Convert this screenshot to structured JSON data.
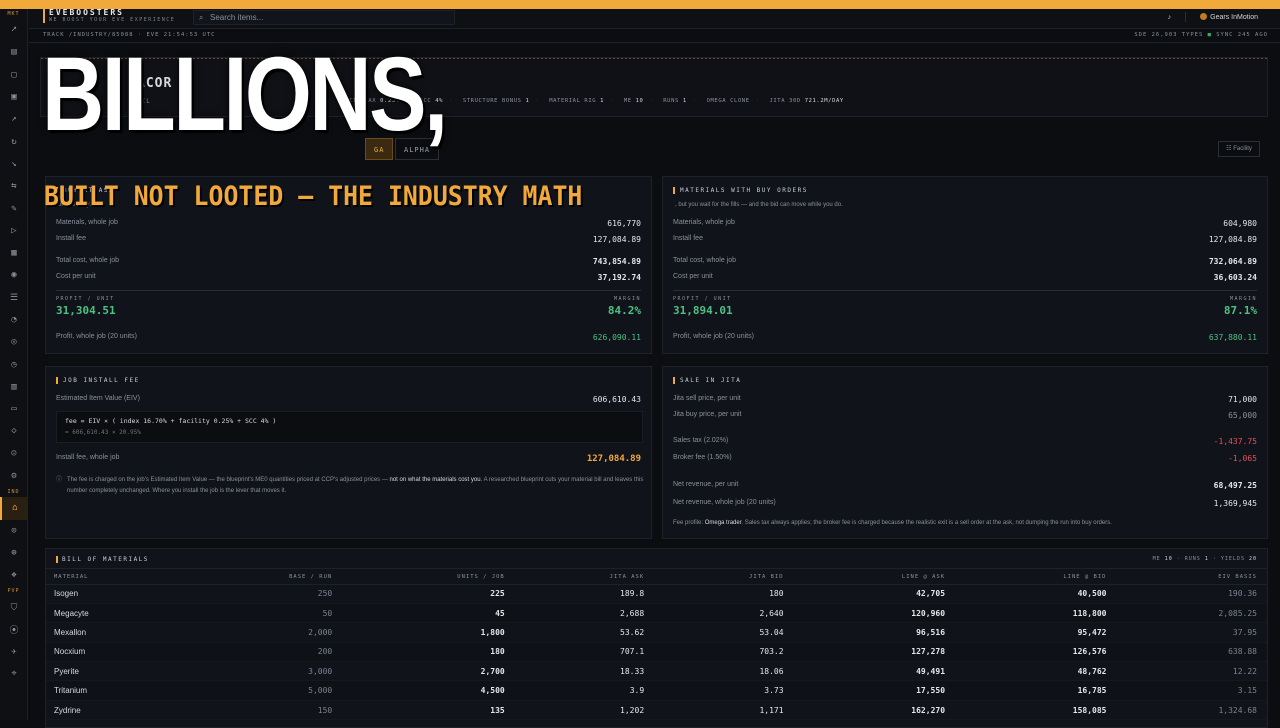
{
  "brand": {
    "name": "EVEBOOSTERS",
    "tagline": "WE BOOST YOUR EVE EXPERIENCE"
  },
  "search": {
    "placeholder": "Search items..."
  },
  "user": {
    "name": "Gears InMotion"
  },
  "breadcrumb": "TRACK /INDUSTRY/85088 · EVE 21:54:53 UTC",
  "sync": {
    "types": "SDE 26,903 TYPES",
    "status": "SYNC 245 AGO"
  },
  "rail": {
    "sections": [
      "MKT",
      "IND",
      "PVP"
    ]
  },
  "stats_bar": [
    {
      "label": "ILITY TAX",
      "value": "0.25%"
    },
    {
      "label": "SCC",
      "value": "4%"
    },
    {
      "label": "STRUCTURE BONUS",
      "value": "1"
    },
    {
      "label": "MATERIAL RIG",
      "value": "1"
    },
    {
      "label": "ME",
      "value": "10"
    },
    {
      "label": "RUNS",
      "value": "1"
    },
    {
      "label": "OMEGA CLONE",
      "value": ""
    },
    {
      "label": "JITA 30D",
      "value": "721.2M/DAY"
    }
  ],
  "title_fragments": {
    "a": "ACOR P",
    "b": "JIL"
  },
  "tabs": {
    "omega": "GA",
    "alpha": "ALPHA"
  },
  "facility_button": "Facility",
  "overlay": {
    "title": "BILLIONS,",
    "subtitle": "BUILT NOT LOOTED — THE INDUSTRY MATH"
  },
  "left_card": {
    "title": "BUY AT ASK",
    "subtitle": "orders                                                     oday.",
    "materials_label": "Materials, whole job",
    "materials": "616,770",
    "install_label": "Install fee",
    "install": "127,084.89",
    "total_label": "Total cost, whole job",
    "total": "743,854.89",
    "cpu_label": "Cost per unit",
    "cpu": "37,192.74",
    "profit_label": "PROFIT / UNIT",
    "profit": "31,304.51",
    "margin_label": "MARGIN",
    "margin": "84.2%",
    "whole_label": "Profit, whole job (20 units)",
    "whole": "626,090.11"
  },
  "right_card": {
    "title": "MATERIALS WITH BUY ORDERS",
    "subtitle": ", but you wait for the fills — and the bid can move while you do.",
    "materials_label": "Materials, whole job",
    "materials": "604,980",
    "install_label": "Install fee",
    "install": "127,084.89",
    "total_label": "Total cost, whole job",
    "total": "732,064.89",
    "cpu_label": "Cost per unit",
    "cpu": "36,603.24",
    "profit_label": "PROFIT / UNIT",
    "profit": "31,894.01",
    "margin_label": "MARGIN",
    "margin": "87.1%",
    "whole_label": "Profit, whole job (20 units)",
    "whole": "637,880.11"
  },
  "install_card": {
    "title": "JOB INSTALL FEE",
    "eiv_label": "Estimated Item Value (EIV)",
    "eiv": "606,610.43",
    "formula": "fee = EIV × ( index 16.70% + facility 0.25% + SCC 4% )",
    "formula_sub": "= 606,610.43 × 20.95%",
    "fee_label": "Install fee, whole job",
    "fee": "127,084.89",
    "note_a": "The fee is charged on the job's Estimated Item Value — the blueprint's ME0 quantities priced at CCP's adjusted prices — ",
    "note_b": "not on what the materials cost you",
    "note_c": ". A researched blueprint cuts your material bill and leaves this number completely unchanged. Where you install the job is the lever that moves it."
  },
  "sale_card": {
    "title": "SALE IN JITA",
    "sell_label": "Jita sell price, per unit",
    "sell": "71,000",
    "buy_label": "Jita buy price, per unit",
    "buy": "65,000",
    "tax_label": "Sales tax (2.02%)",
    "tax": "-1,437.75",
    "broker_label": "Broker fee (1.50%)",
    "broker": "-1,065",
    "net_label": "Net revenue, per unit",
    "net": "68,497.25",
    "netjob_label": "Net revenue, whole job (20 units)",
    "netjob": "1,369,945",
    "profile_a": "Fee profile: ",
    "profile_b": "Omega trader",
    "profile_c": ". Sales tax always applies; the broker fee is charged because the realistic exit is a sell order at the ask, not dumping the run into buy orders."
  },
  "bom": {
    "title": "BILL OF MATERIALS",
    "meta": {
      "me_label": "ME",
      "me": "10",
      "runs_label": "RUNS",
      "runs": "1",
      "yields_label": "YIELDS",
      "yields": "20"
    },
    "columns": [
      "MATERIAL",
      "BASE / RUN",
      "UNITS / JOB",
      "JITA ASK",
      "JITA BID",
      "LINE @ ASK",
      "LINE @ BID",
      "EIV BASIS"
    ],
    "rows": [
      [
        "Isogen",
        "250",
        "225",
        "189.8",
        "180",
        "42,705",
        "40,500",
        "190.36"
      ],
      [
        "Megacyte",
        "50",
        "45",
        "2,688",
        "2,640",
        "120,960",
        "118,800",
        "2,085.25"
      ],
      [
        "Mexallon",
        "2,000",
        "1,800",
        "53.62",
        "53.04",
        "96,516",
        "95,472",
        "37.95"
      ],
      [
        "Nocxium",
        "200",
        "180",
        "707.1",
        "703.2",
        "127,278",
        "126,576",
        "638.88"
      ],
      [
        "Pyerite",
        "3,000",
        "2,700",
        "18.33",
        "18.06",
        "49,491",
        "48,762",
        "12.22"
      ],
      [
        "Tritanium",
        "5,000",
        "4,500",
        "3.9",
        "3.73",
        "17,550",
        "16,785",
        "3.15"
      ],
      [
        "Zydrine",
        "150",
        "135",
        "1,202",
        "1,171",
        "162,270",
        "158,085",
        "1,324.68"
      ]
    ]
  }
}
